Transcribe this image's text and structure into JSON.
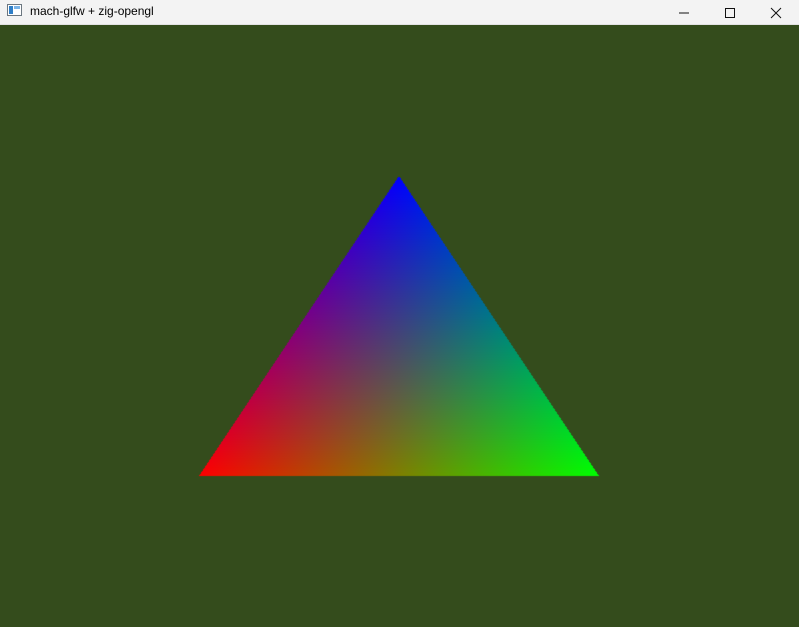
{
  "window": {
    "title": "mach-glfw + zig-opengl",
    "icon": "app-window-icon",
    "controls": [
      {
        "name": "minimize-button",
        "icon": "minimize-icon"
      },
      {
        "name": "maximize-button",
        "icon": "maximize-icon"
      },
      {
        "name": "close-button",
        "icon": "close-icon"
      }
    ]
  },
  "scene": {
    "clear_color": "#344c1c",
    "triangle": {
      "vertices": [
        {
          "label": "top",
          "color": "#0000ff"
        },
        {
          "label": "bottom-left",
          "color": "#ff0000"
        },
        {
          "label": "bottom-right",
          "color": "#00ff00"
        }
      ]
    }
  }
}
